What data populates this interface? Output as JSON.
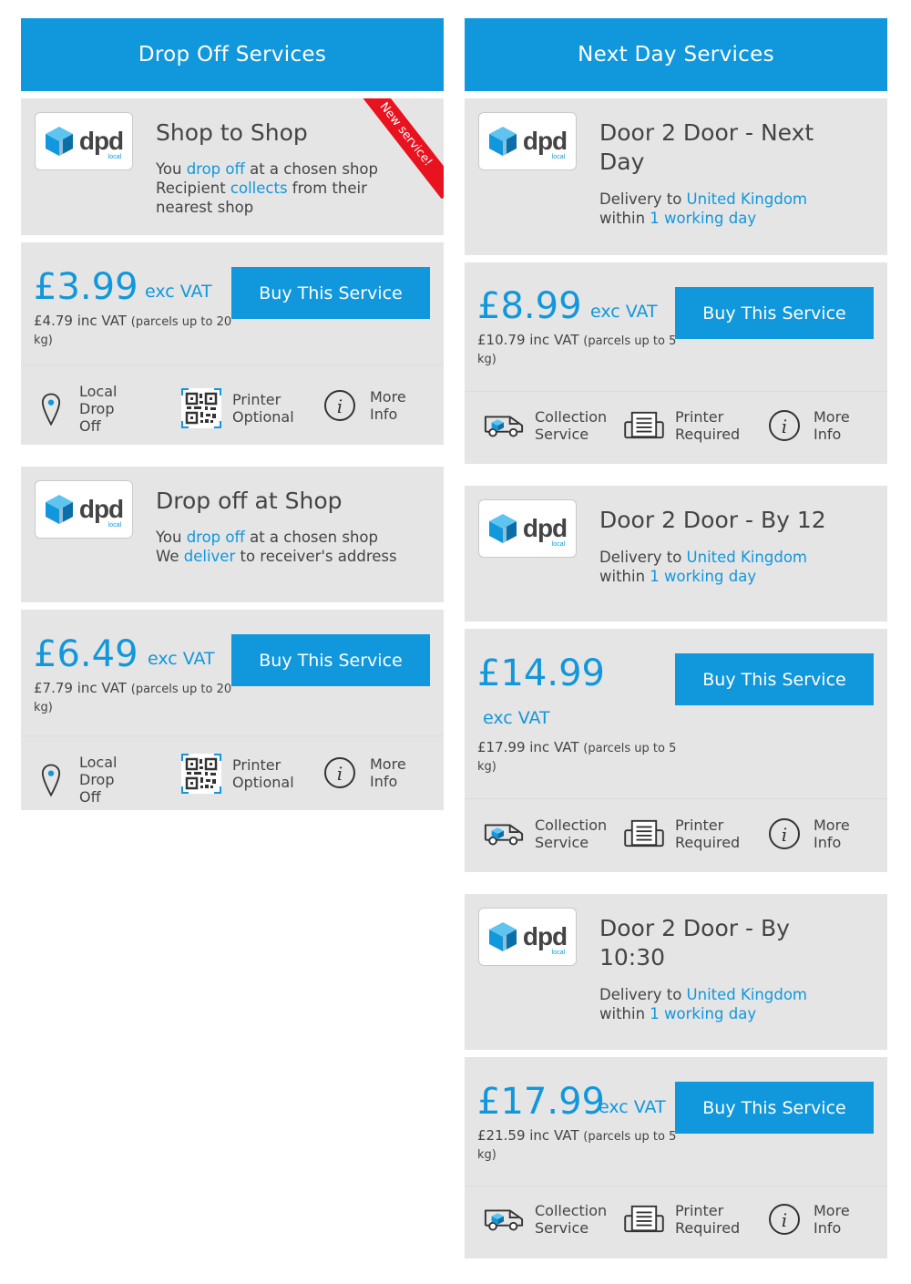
{
  "drop_off": {
    "header": "Drop Off Services",
    "services": [
      {
        "logo_text": "dpd",
        "logo_sub": "local",
        "title": "Shop to Shop",
        "ribbon": "New service!",
        "desc_line1": [
          "You ",
          "drop off",
          " at a chosen shop"
        ],
        "desc_line2": [
          "Recipient ",
          "collects",
          " from their"
        ],
        "desc_line3": "nearest shop",
        "price": "£3.99",
        "exc": "exc VAT",
        "inc": "£4.79 inc VAT",
        "inc_note": "(parcels up to 20 kg)",
        "buy": "Buy This Service",
        "features": [
          "Local Drop Off",
          "Printer Optional",
          "More Info"
        ]
      },
      {
        "logo_text": "dpd",
        "logo_sub": "local",
        "title": "Drop off at Shop",
        "desc_line1": [
          "You ",
          "drop off",
          " at a chosen shop"
        ],
        "desc_line2": [
          "We ",
          "deliver",
          " to receiver's address"
        ],
        "price": "£6.49",
        "exc": "exc VAT",
        "inc": "£7.79 inc VAT",
        "inc_note": "(parcels up to 20 kg)",
        "buy": "Buy This Service",
        "features": [
          "Local Drop Off",
          "Printer Optional",
          "More Info"
        ]
      }
    ]
  },
  "next_day": {
    "header": "Next Day Services",
    "services": [
      {
        "logo_text": "dpd",
        "logo_sub": "local",
        "title": "Door 2 Door - Next Day",
        "desc_line1": [
          "Delivery to ",
          "United Kingdom"
        ],
        "desc_line2": [
          "within ",
          "1 working day"
        ],
        "price": "£8.99",
        "exc": "exc VAT",
        "inc": "£10.79 inc VAT",
        "inc_note": "(parcels up to 5 kg)",
        "buy": "Buy This Service",
        "features": [
          "Collection Service",
          "Printer Required",
          "More Info"
        ]
      },
      {
        "logo_text": "dpd",
        "logo_sub": "local",
        "title": "Door 2 Door - By 12",
        "desc_line1": [
          "Delivery to ",
          "United Kingdom"
        ],
        "desc_line2": [
          "within ",
          "1 working day"
        ],
        "price": "£14.99",
        "exc": "exc VAT",
        "inc": "£17.99 inc VAT",
        "inc_note": "(parcels up to 5 kg)",
        "buy": "Buy This Service",
        "features": [
          "Collection Service",
          "Printer Required",
          "More Info"
        ]
      },
      {
        "logo_text": "dpd",
        "logo_sub": "local",
        "title": "Door 2 Door - By 10:30",
        "desc_line1": [
          "Delivery to ",
          "United Kingdom"
        ],
        "desc_line2": [
          "within ",
          "1 working day"
        ],
        "price": "£17.99",
        "exc": "exc VAT",
        "inc": "£21.59 inc VAT",
        "inc_note": "(parcels up to 5 kg)",
        "buy": "Buy This Service",
        "features": [
          "Collection Service",
          "Printer Required",
          "More Info"
        ]
      }
    ]
  },
  "colors": {
    "accent": "#1197dc",
    "card": "#e5e5e5",
    "ribbon": "#e8131f",
    "text": "#444444"
  },
  "icons": [
    "dpd-cube-icon",
    "map-pin-icon",
    "qr-code-icon",
    "info-icon",
    "van-icon",
    "printer-icon"
  ]
}
